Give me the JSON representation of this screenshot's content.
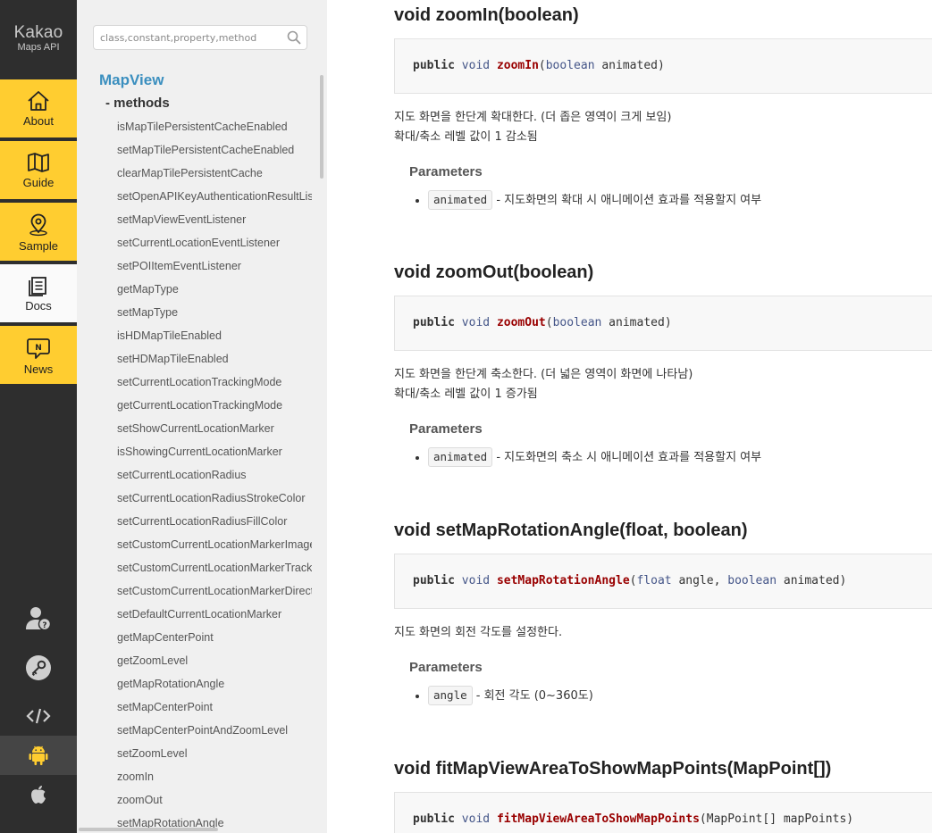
{
  "logo": {
    "line1": "Kakao",
    "line2": "Maps API"
  },
  "nav": [
    {
      "icon": "home-icon",
      "label": "About"
    },
    {
      "icon": "map-icon",
      "label": "Guide"
    },
    {
      "icon": "location-pin-icon",
      "label": "Sample"
    },
    {
      "icon": "docs-icon",
      "label": "Docs",
      "active": true
    },
    {
      "icon": "news-icon",
      "label": "News"
    }
  ],
  "rail_bottom_icons": [
    "user-help-icon",
    "key-icon",
    "code-icon",
    "android-icon",
    "apple-icon"
  ],
  "colors": {
    "accent": "#ffcd30",
    "rail": "#2e2e2e",
    "link": "#3b8fbf"
  },
  "search": {
    "placeholder": "class,constant,property,method",
    "value": ""
  },
  "sidebar": {
    "class_title": "MapView",
    "methods_heading": "- methods",
    "methods": [
      "isMapTilePersistentCacheEnabled",
      "setMapTilePersistentCacheEnabled",
      "clearMapTilePersistentCache",
      "setOpenAPIKeyAuthenticationResultListener",
      "setMapViewEventListener",
      "setCurrentLocationEventListener",
      "setPOIItemEventListener",
      "getMapType",
      "setMapType",
      "isHDMapTileEnabled",
      "setHDMapTileEnabled",
      "setCurrentLocationTrackingMode",
      "getCurrentLocationTrackingMode",
      "setShowCurrentLocationMarker",
      "isShowingCurrentLocationMarker",
      "setCurrentLocationRadius",
      "setCurrentLocationRadiusStrokeColor",
      "setCurrentLocationRadiusFillColor",
      "setCustomCurrentLocationMarkerImage",
      "setCustomCurrentLocationMarkerTrackingImage",
      "setCustomCurrentLocationMarkerDirectionImage",
      "setDefaultCurrentLocationMarker",
      "getMapCenterPoint",
      "getZoomLevel",
      "getMapRotationAngle",
      "setMapCenterPoint",
      "setMapCenterPointAndZoomLevel",
      "setZoomLevel",
      "zoomIn",
      "zoomOut",
      "setMapRotationAngle"
    ]
  },
  "content": {
    "m1": {
      "heading": "void zoomIn(boolean)",
      "code": {
        "kw1": "public",
        "kw2": "void",
        "fn": "zoomIn",
        "open": "(",
        "t1": "boolean",
        "a1": " animated",
        "close": ")"
      },
      "desc": [
        "지도 화면을 한단계 확대한다. (더 좁은 영역이 크게 보임)",
        "확대/축소 레벨 값이 1 감소됨"
      ],
      "params_heading": "Parameters",
      "param": {
        "name": "animated",
        "desc": " - 지도화면의 확대 시 애니메이션 효과를 적용할지 여부"
      }
    },
    "m2": {
      "heading": "void zoomOut(boolean)",
      "code": {
        "kw1": "public",
        "kw2": "void",
        "fn": "zoomOut",
        "open": "(",
        "t1": "boolean",
        "a1": " animated",
        "close": ")"
      },
      "desc": [
        "지도 화면을 한단계 축소한다. (더 넓은 영역이 화면에 나타남)",
        "확대/축소 레벨 값이 1 증가됨"
      ],
      "params_heading": "Parameters",
      "param": {
        "name": "animated",
        "desc": " - 지도화면의 축소 시 애니메이션 효과를 적용할지 여부"
      }
    },
    "m3": {
      "heading": "void setMapRotationAngle(float, boolean)",
      "code": {
        "kw1": "public",
        "kw2": "void",
        "fn": "setMapRotationAngle",
        "open": "(",
        "t1": "float",
        "a1": " angle, ",
        "t2": "boolean",
        "a2": " animated",
        "close": ")"
      },
      "desc": [
        "지도 화면의 회전 각도를 설정한다."
      ],
      "params_heading": "Parameters",
      "param": {
        "name": "angle",
        "desc": " - 회전 각도 (0~360도)"
      }
    },
    "m4": {
      "heading": "void fitMapViewAreaToShowMapPoints(MapPoint[])",
      "code": {
        "kw1": "public",
        "kw2": "void",
        "fn": "fitMapViewAreaToShowMapPoints",
        "open": "(",
        "a1": "MapPoint[] mapPoints",
        "close": ")"
      }
    }
  }
}
